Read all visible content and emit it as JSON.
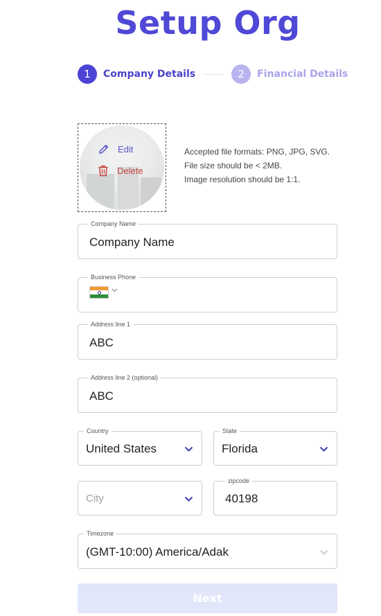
{
  "page": {
    "title": "Setup Org",
    "accent_color": "#5048d6"
  },
  "stepper": {
    "steps": [
      {
        "number": "1",
        "label": "Company Details",
        "state": "active"
      },
      {
        "number": "2",
        "label": "Financial Details",
        "state": "inactive"
      }
    ]
  },
  "logo_upload": {
    "edit_label": "Edit",
    "delete_label": "Delete",
    "hints": [
      "Accepted file formats: PNG, JPG, SVG.",
      "File size should be < 2MB.",
      "Image resolution should be 1:1."
    ]
  },
  "form": {
    "company_name": {
      "label": "Company Name",
      "value": "Company Name"
    },
    "business_phone": {
      "label": "Business Phone",
      "country_flag": "india-flag-icon",
      "value": ""
    },
    "address_line_1": {
      "label": "Address line 1",
      "value": "ABC"
    },
    "address_line_2": {
      "label": "Address line 2 (optional)",
      "value": "ABC"
    },
    "country": {
      "label": "Country",
      "value": "United States"
    },
    "state": {
      "label": "State",
      "value": "Florida"
    },
    "city": {
      "placeholder": "City",
      "value": ""
    },
    "zipcode": {
      "label": "zipcode",
      "value": "40198"
    },
    "timezone": {
      "label": "Timezone",
      "value": "(GMT-10:00) America/Adak"
    }
  },
  "actions": {
    "next_label": "Next"
  }
}
